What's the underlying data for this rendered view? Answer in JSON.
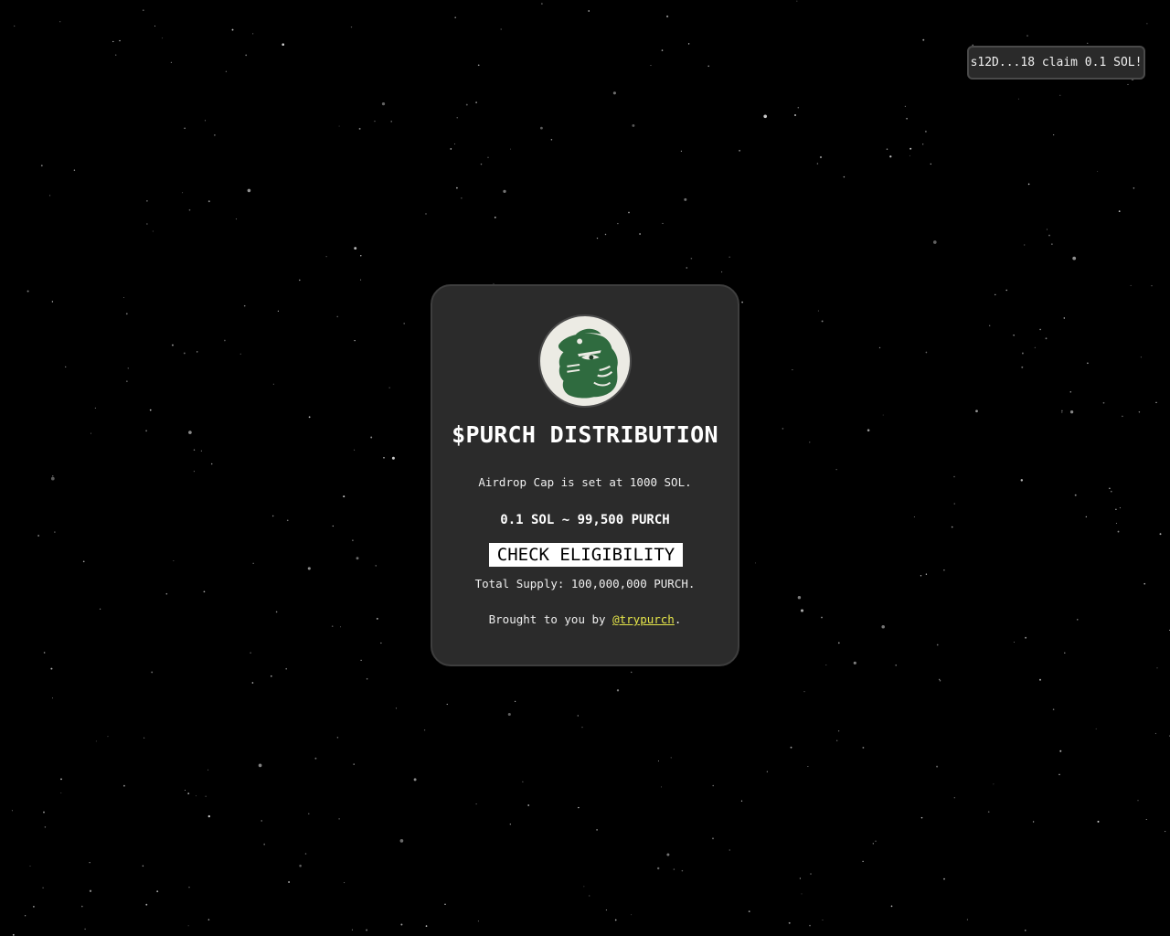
{
  "notification": {
    "text": "s12D...18 claim 0.1 SOL!"
  },
  "card": {
    "logo_icon": "green-panther-head-logo",
    "title": "$PURCH DISTRIBUTION",
    "airdrop_cap": "Airdrop Cap is set at 1000 SOL.",
    "rate": "0.1 SOL ~ 99,500 PURCH",
    "check_button_label": "CHECK ELIGIBILITY",
    "total_supply": "Total Supply: 100,000,000 PURCH.",
    "credit_prefix": "Brought to you by ",
    "credit_link": "@trypurch",
    "credit_suffix": "."
  },
  "colors": {
    "background": "#000000",
    "card_bg": "#2b2b2b",
    "logo_green": "#2f6b3f",
    "logo_bg": "#ecebe4",
    "link": "#e6e64a"
  }
}
